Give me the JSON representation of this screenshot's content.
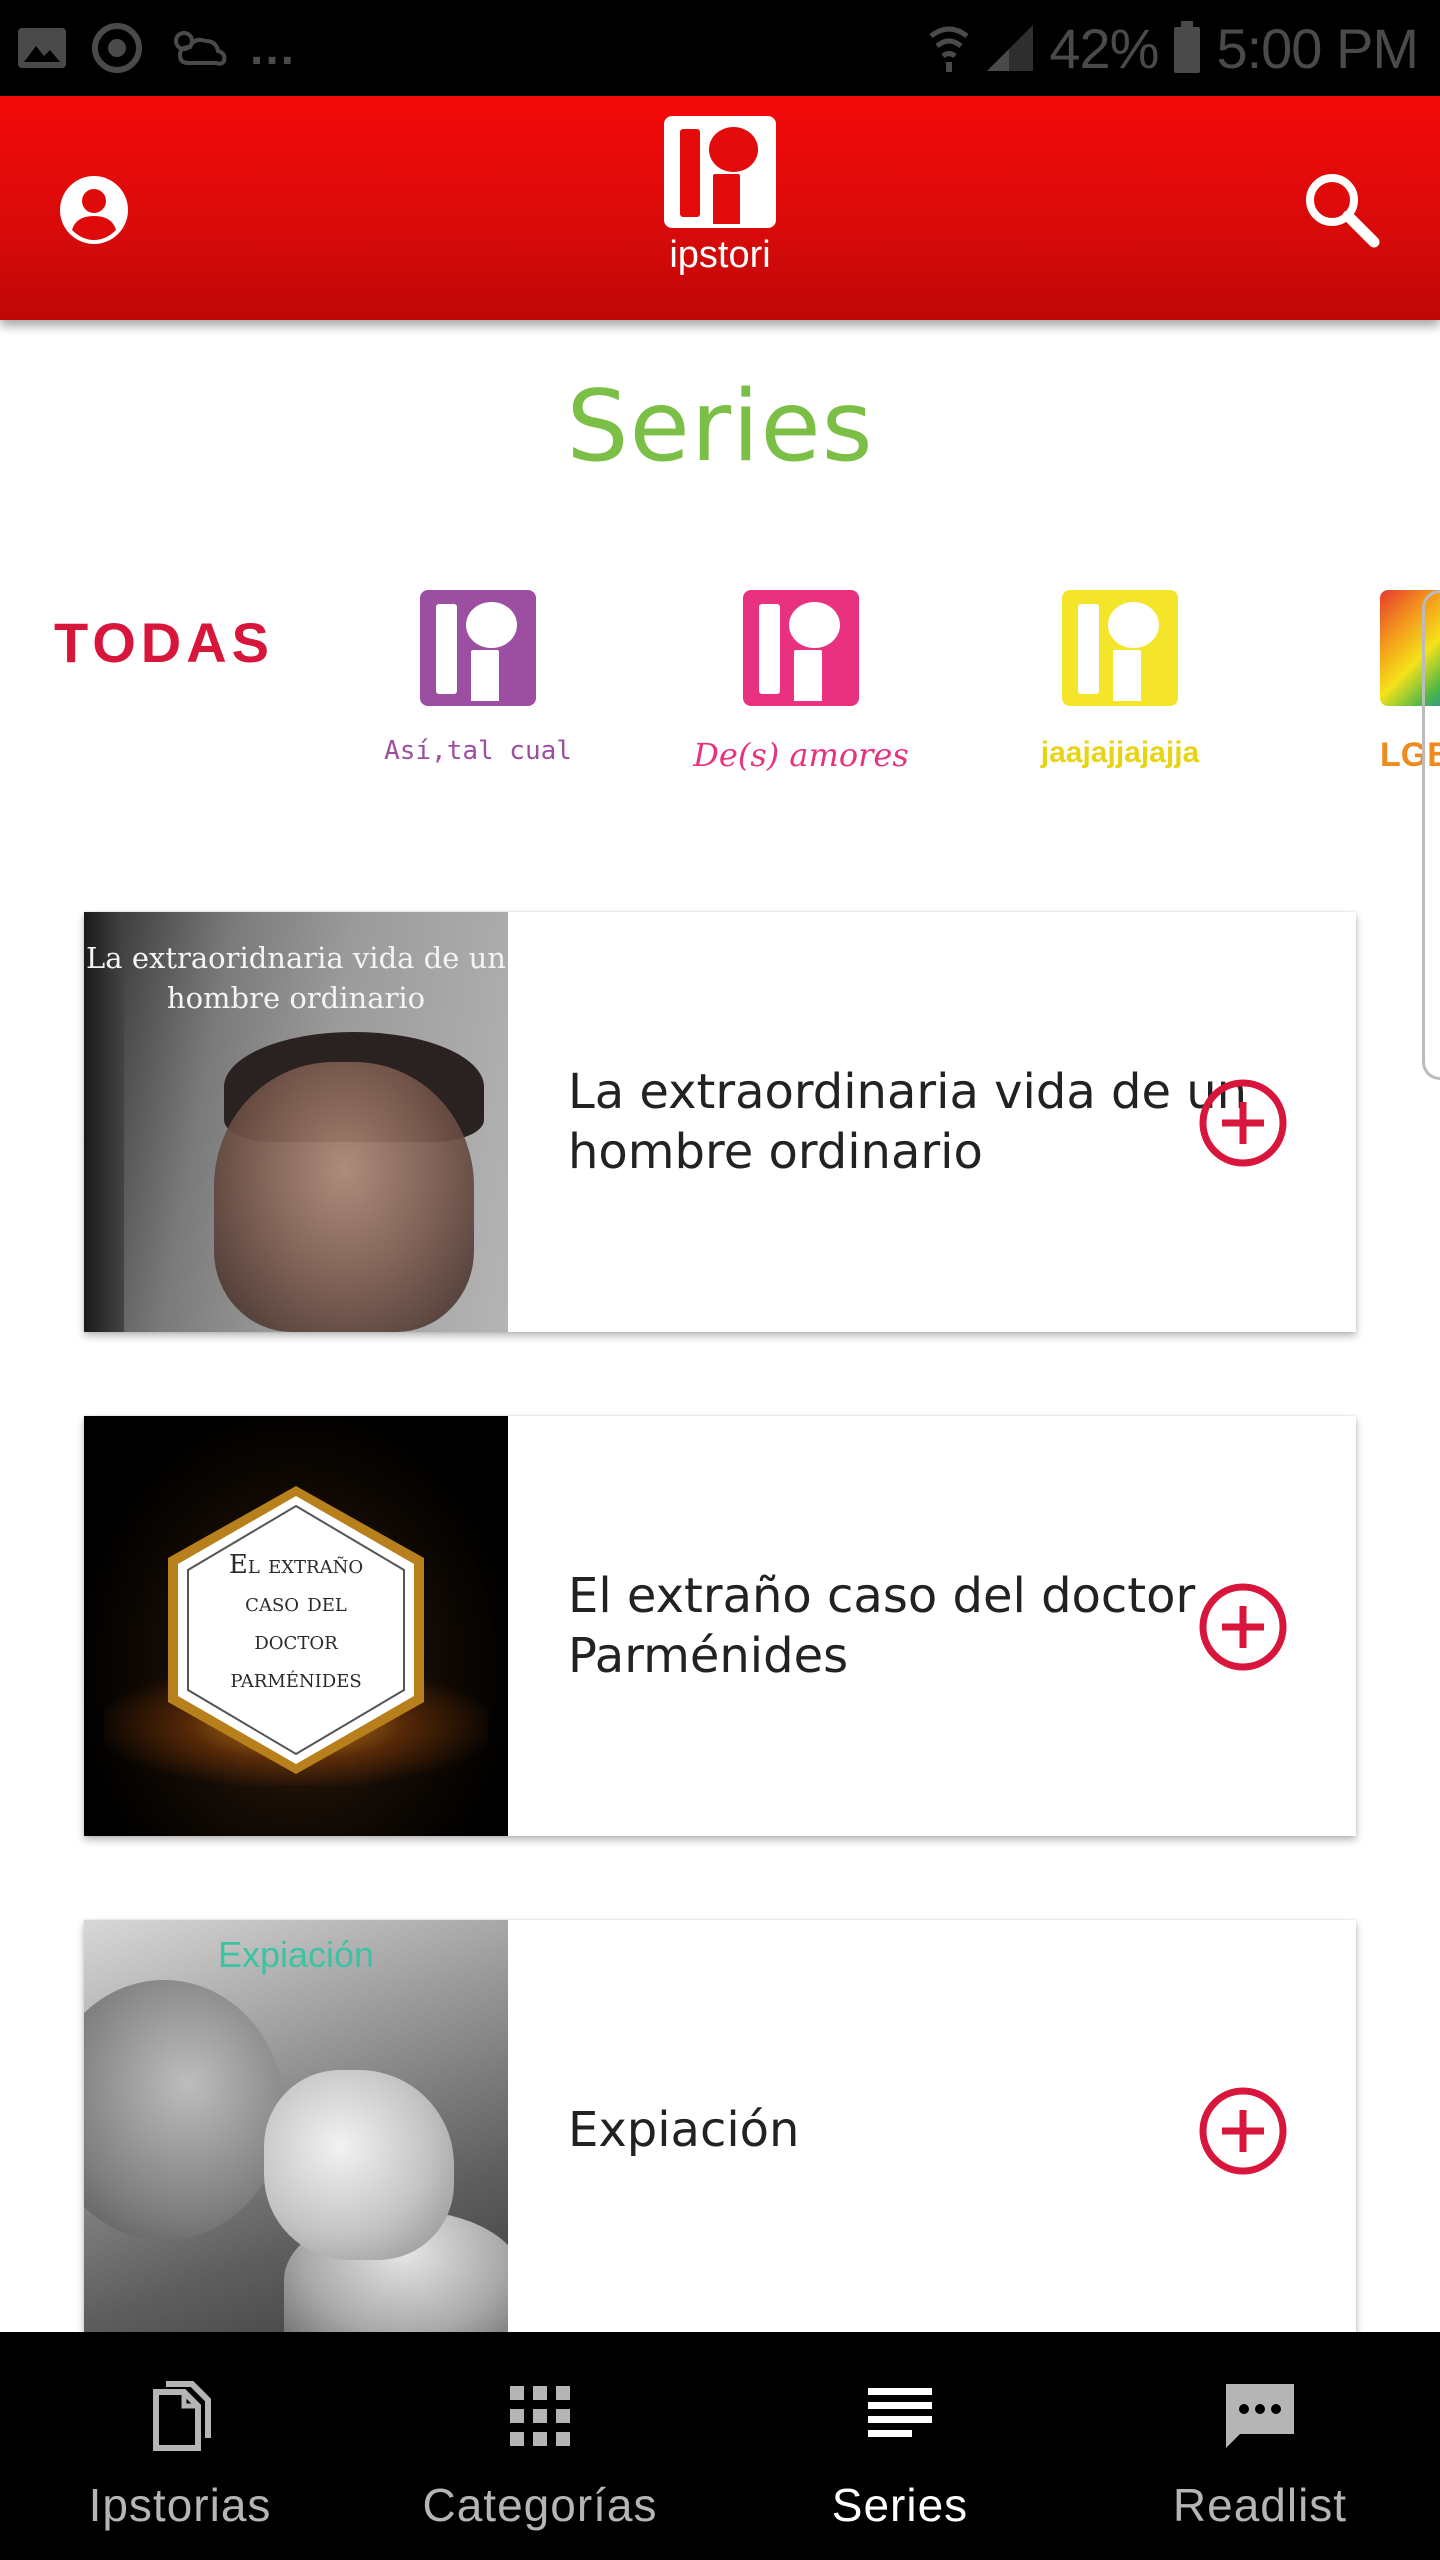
{
  "status_bar": {
    "dots": "...",
    "battery": "42%",
    "time": "5:00 PM"
  },
  "header": {
    "logo_text": "ipstori"
  },
  "page": {
    "title": "Series"
  },
  "categories": {
    "all_label": "TODAS",
    "items": [
      {
        "label": "Así,tal cual",
        "color": "#9c4fa0"
      },
      {
        "label": "De(s) amores",
        "color": "#e8317f"
      },
      {
        "label": "jaajajjajajja",
        "color": "#f5e52a"
      },
      {
        "label": "LGB",
        "color": "#f08a1c"
      }
    ]
  },
  "series": [
    {
      "title": "La extraordinaria vida de un hombre ordinario",
      "thumb_text": "La extraoridnaria vida de un hombre ordinario"
    },
    {
      "title": "El extraño caso del doctor Parménides",
      "thumb_lines": [
        "El extraño",
        "caso del",
        "doctor",
        "parménides"
      ]
    },
    {
      "title": "Expiación",
      "thumb_text": "Expiación"
    }
  ],
  "bottom_nav": {
    "items": [
      {
        "label": "Ipstorias",
        "icon": "document-icon"
      },
      {
        "label": "Categorías",
        "icon": "grid-icon"
      },
      {
        "label": "Series",
        "icon": "list-icon",
        "active": true
      },
      {
        "label": "Readlist",
        "icon": "chat-icon"
      }
    ]
  },
  "colors": {
    "brand_red": "#e30b0b",
    "accent_red": "#d8153a",
    "title_green": "#7cbf47"
  }
}
